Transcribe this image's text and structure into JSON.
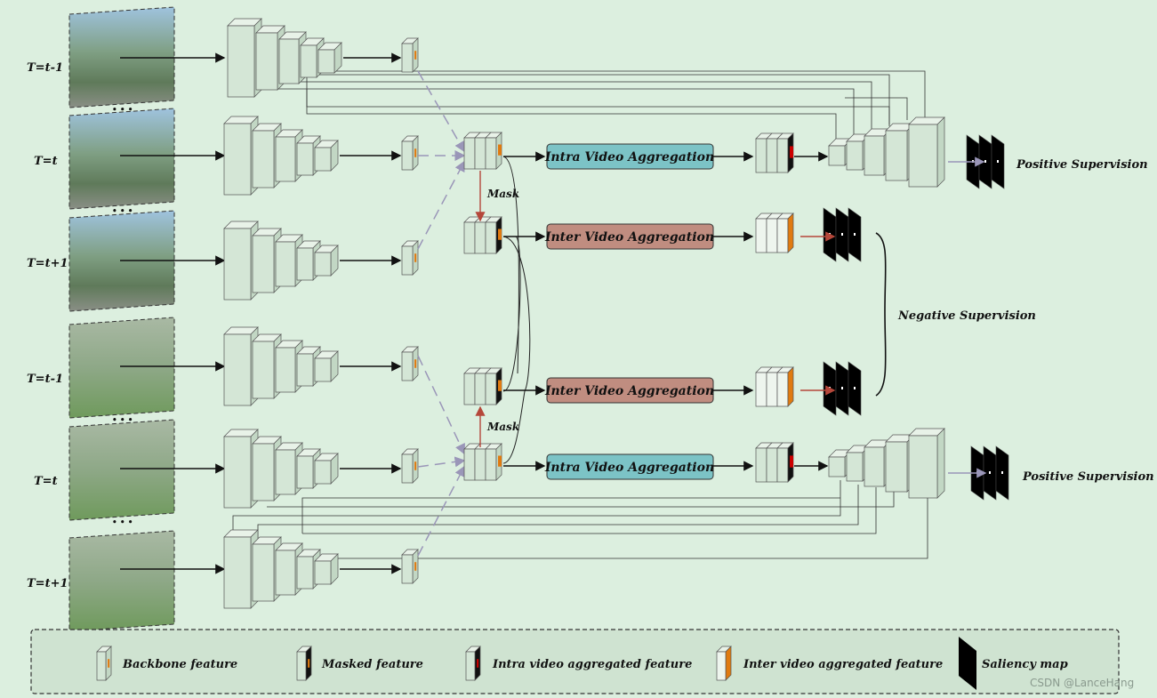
{
  "frames": [
    "T=t-1",
    "T=t",
    "T=t+1",
    "T=t-1",
    "T=t",
    "T=t+1"
  ],
  "modules": {
    "intra": "Intra Video Aggregation",
    "inter": "Inter Video Aggregation"
  },
  "mask_label": "Mask",
  "positive_supervision": "Positive Supervision",
  "negative_supervision": "Negative Supervision",
  "ellipsis": "• • •",
  "legend": {
    "backbone": "Backbone feature",
    "masked": "Masked feature",
    "intra": "Intra video aggregated feature",
    "inter": "Inter video aggregated feature",
    "saliency": "Saliency map"
  },
  "watermark": "CSDN @LanceHang",
  "colors": {
    "background": "#dcefdf",
    "intra_module": "#7cc3c6",
    "inter_module": "#c08d80",
    "feature_face": "#d4e6d6",
    "highlight": "#e07a10",
    "mask_arrow": "#b5473a",
    "dashed_link": "#9a96b8"
  }
}
